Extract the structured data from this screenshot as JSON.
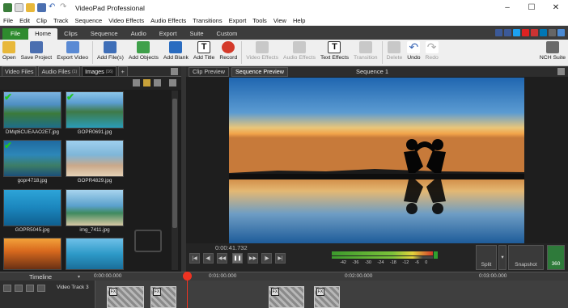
{
  "window": {
    "title": "VideoPad Professional",
    "controls": [
      "–",
      "☐",
      "✕"
    ]
  },
  "menu": [
    "File",
    "Edit",
    "Clip",
    "Track",
    "Sequence",
    "Video Effects",
    "Audio Effects",
    "Transitions",
    "Export",
    "Tools",
    "View",
    "Help"
  ],
  "ribbon_tabs": [
    "File",
    "Home",
    "Clips",
    "Sequence",
    "Audio",
    "Export",
    "Suite",
    "Custom"
  ],
  "ribbon_active": "Home",
  "ribbon": {
    "open": "Open",
    "save_project": "Save Project",
    "export_video": "Export Video",
    "add_files": "Add File(s)",
    "add_objects": "Add Objects",
    "add_blank": "Add Blank",
    "add_title": "Add Title",
    "record": "Record",
    "video_effects": "Video Effects",
    "audio_effects": "Audio Effects",
    "text_effects": "Text Effects",
    "transition": "Transition",
    "delete": "Delete",
    "undo": "Undo",
    "redo": "Redo",
    "nch_suite": "NCH Suite"
  },
  "bin_tabs": {
    "video_files": "Video Files",
    "audio_files": "Audio Files",
    "audio_count": "(1)",
    "images": "Images",
    "images_count": "(16)",
    "add": "+"
  },
  "images": [
    {
      "name": "DMqt6CUEAAO2ET.jpg",
      "used": true
    },
    {
      "name": "GOPR0691.jpg",
      "used": true
    },
    {
      "name": "gopr4718.jpg",
      "used": true
    },
    {
      "name": "GOPR4829.jpg",
      "used": false
    },
    {
      "name": "GOPR5045.jpg",
      "used": false
    },
    {
      "name": "img_7411.jpg",
      "used": false
    },
    {
      "name": "",
      "used": false
    },
    {
      "name": "",
      "used": false
    }
  ],
  "preview_tabs": {
    "clip_preview": "Clip Preview",
    "sequence_preview": "Sequence Preview",
    "sequence_name": "Sequence 1"
  },
  "playback": {
    "timecode": "0:00:41.732",
    "meter_labels": "-42 -36 -30 -24 -18 -12 -6 0"
  },
  "side_buttons": {
    "split": "Split",
    "snapshot": "Snapshot",
    "vr": "360"
  },
  "timeline": {
    "label": "Timeline",
    "ticks": [
      "0:00:00.000",
      "0:01:00.000",
      "0:02:00.000",
      "0:03:00.000"
    ],
    "track_name": "Video Track 3"
  },
  "colors": {
    "file_tab": "#2e8b2e",
    "check": "#23c423",
    "playhead": "#e33322"
  }
}
